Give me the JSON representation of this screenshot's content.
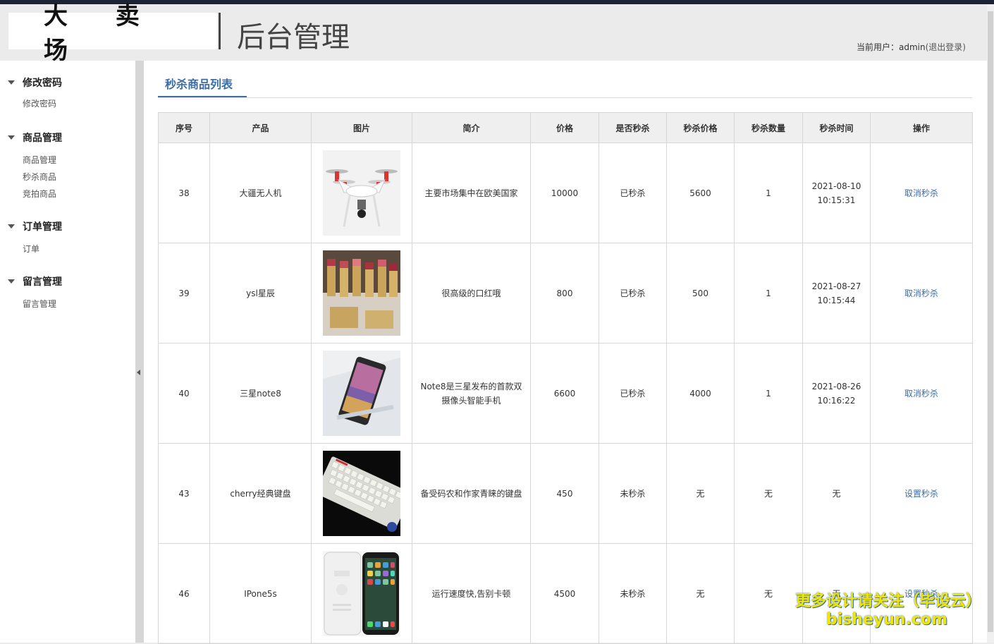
{
  "header": {
    "logo": "大 卖 场",
    "title": "后台管理",
    "user_prefix": "当前用户：",
    "username": "admin",
    "logout": "(退出登录)"
  },
  "sidebar": {
    "groups": [
      {
        "title": "修改密码",
        "items": [
          "修改密码"
        ]
      },
      {
        "title": "商品管理",
        "items": [
          "商品管理",
          "秒杀商品",
          "竞拍商品"
        ]
      },
      {
        "title": "订单管理",
        "items": [
          "订单"
        ]
      },
      {
        "title": "留言管理",
        "items": [
          "留言管理"
        ]
      }
    ]
  },
  "main": {
    "tab_title": "秒杀商品列表",
    "columns": [
      "序号",
      "产品",
      "图片",
      "简介",
      "价格",
      "是否秒杀",
      "秒杀价格",
      "秒杀数量",
      "秒杀时间",
      "操作"
    ],
    "rows": [
      {
        "id": "38",
        "name": "大疆无人机",
        "image": "drone-image",
        "desc": "主要市场集中在欧美国家",
        "price": "10000",
        "status": "已秒杀",
        "sale_price": "5600",
        "qty": "1",
        "time": "2021-08-10\n10:15:31",
        "action": "取消秒杀"
      },
      {
        "id": "39",
        "name": "ysl星辰",
        "image": "lipstick-image",
        "desc": "很高级的口红哦",
        "price": "800",
        "status": "已秒杀",
        "sale_price": "500",
        "qty": "1",
        "time": "2021-08-27\n10:15:44",
        "action": "取消秒杀"
      },
      {
        "id": "40",
        "name": "三星note8",
        "image": "phone-image",
        "desc": "Note8是三星发布的首款双摄像头智能手机",
        "price": "6600",
        "status": "已秒杀",
        "sale_price": "4000",
        "qty": "1",
        "time": "2021-08-26\n10:16:22",
        "action": "取消秒杀"
      },
      {
        "id": "43",
        "name": "cherry经典键盘",
        "image": "keyboard-image",
        "desc": "备受码农和作家青睐的键盘",
        "price": "450",
        "status": "未秒杀",
        "sale_price": "无",
        "qty": "无",
        "time": "无",
        "action": "设置秒杀"
      },
      {
        "id": "46",
        "name": "IPone5s",
        "image": "iphone-image",
        "desc": "运行速度快,告别卡顿",
        "price": "4500",
        "status": "未秒杀",
        "sale_price": "无",
        "qty": "无",
        "time": "无",
        "action": "设置秒杀"
      }
    ]
  },
  "watermark": {
    "line1": "更多设计请关注（毕设云）",
    "line2": "bisheyun.com"
  },
  "colors": {
    "accent": "#3a6ea5",
    "topbar": "#1b2437",
    "header_bg": "#ebebeb"
  }
}
